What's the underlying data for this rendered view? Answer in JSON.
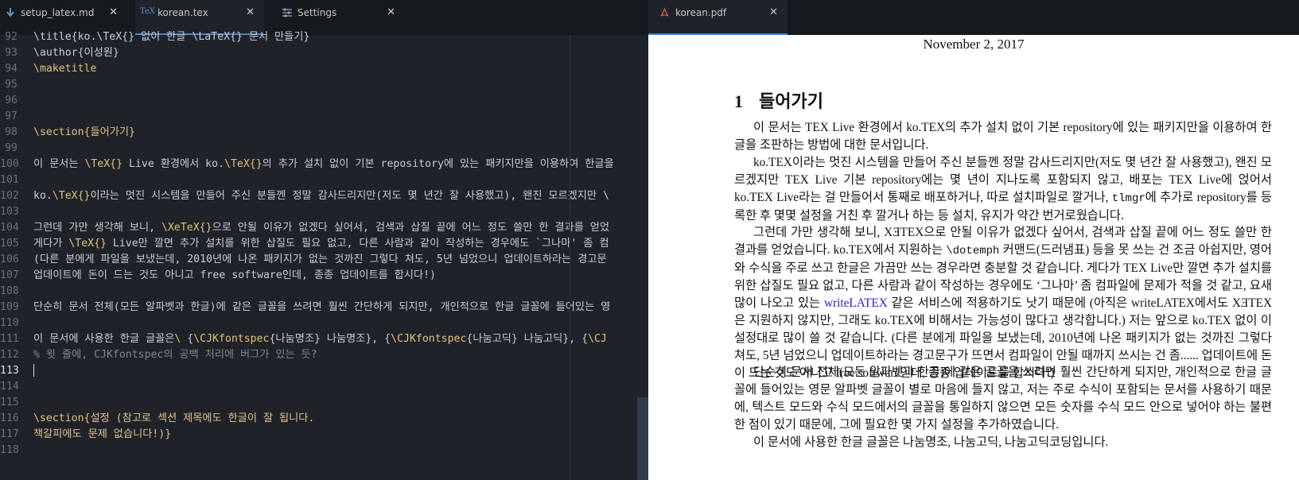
{
  "tabs": [
    {
      "label": "setup_latex.md",
      "icon": "markdown-arrow-icon",
      "active": false
    },
    {
      "label": "korean.tex",
      "icon": "tex-file-icon",
      "active": true
    },
    {
      "label": "Settings",
      "icon": "settings-sliders-icon",
      "active": false
    }
  ],
  "pdf_tab": {
    "label": "korean.pdf",
    "icon": "pdf-file-icon"
  },
  "close_glyph": "✕",
  "editor": {
    "lines": [
      {
        "n": "92",
        "segments": [
          {
            "t": "\\title{ko.\\TeX{} 없이 한글 \\LaTeX{} 문서 만들기}",
            "c": "txt"
          }
        ]
      },
      {
        "n": "93",
        "segments": [
          {
            "t": "\\author",
            "c": "txt"
          },
          {
            "t": "{이성원}",
            "c": "txt"
          }
        ]
      },
      {
        "n": "94",
        "segments": [
          {
            "t": "\\maketitle",
            "c": "kw"
          }
        ]
      },
      {
        "n": "95",
        "segments": []
      },
      {
        "n": "96",
        "segments": []
      },
      {
        "n": "97",
        "segments": []
      },
      {
        "n": "98",
        "segments": [
          {
            "t": "\\section{들어가기}",
            "c": "kw"
          }
        ]
      },
      {
        "n": "99",
        "segments": []
      },
      {
        "n": "100",
        "segments": [
          {
            "t": "이 문서는 ",
            "c": "txt"
          },
          {
            "t": "\\TeX{}",
            "c": "kw"
          },
          {
            "t": " Live 환경에서 ko.",
            "c": "txt"
          },
          {
            "t": "\\TeX{}",
            "c": "kw"
          },
          {
            "t": "의 추가 설치 없이 기본 repository에 있는 패키지만을 이용하여 한글을",
            "c": "txt"
          }
        ]
      },
      {
        "n": "101",
        "segments": []
      },
      {
        "n": "102",
        "segments": [
          {
            "t": "ko.",
            "c": "txt"
          },
          {
            "t": "\\TeX{}",
            "c": "kw"
          },
          {
            "t": "이라는 멋진 시스템을 만들어 주신 분들껜 정말 감사드리지만(저도 몇 년간 잘 사용했고), 왠진 모르겠지만 \\",
            "c": "txt"
          }
        ]
      },
      {
        "n": "103",
        "segments": []
      },
      {
        "n": "104",
        "segments": [
          {
            "t": "그런데 가만 생각해 보니, ",
            "c": "txt"
          },
          {
            "t": "\\XeTeX{}",
            "c": "kw"
          },
          {
            "t": "으로 안될 이유가 없겠다 싶어서, 검색과 삽질 끝에 어느 정도 쓸만 한 결과를 얻었",
            "c": "txt"
          }
        ]
      },
      {
        "n": "105",
        "segments": [
          {
            "t": "게다가 ",
            "c": "txt"
          },
          {
            "t": "\\TeX{}",
            "c": "kw"
          },
          {
            "t": " Live만 깔면 추가 설치를 위한 삽질도 필요 없고, 다른 사람과 같이 작성하는 경우에도 `그나마' 좀 컴",
            "c": "txt"
          }
        ]
      },
      {
        "n": "106",
        "segments": [
          {
            "t": "(다른 분에게 파일을 보냈는데, 2010년에 나온 패키지가 없는 것까진 그렇다 쳐도, 5년 넘었으니 업데이트하라는 경고문",
            "c": "txt"
          }
        ]
      },
      {
        "n": "107",
        "segments": [
          {
            "t": "업데이트에 돈이 드는 것도 아니고 free software인데, 종종 업데이트를 합시다!)",
            "c": "txt"
          }
        ]
      },
      {
        "n": "108",
        "segments": []
      },
      {
        "n": "109",
        "segments": [
          {
            "t": "단순히 문서 전체(모든 알파벳과 한글)에 같은 글꼴을 쓰려면 훨씬 간단하게 되지만, 개인적으로 한글 글꼴에 들어있는 영",
            "c": "txt"
          }
        ]
      },
      {
        "n": "110",
        "segments": []
      },
      {
        "n": "111",
        "segments": [
          {
            "t": "이 문서에 사용한 한글 글꼴은",
            "c": "txt"
          },
          {
            "t": "\\ ",
            "c": "kw"
          },
          {
            "t": "{",
            "c": "txt"
          },
          {
            "t": "\\CJKfontspec",
            "c": "kw"
          },
          {
            "t": "{나눔명조} 나눔명조}, {",
            "c": "txt"
          },
          {
            "t": "\\CJKfontspec",
            "c": "kw"
          },
          {
            "t": "{나눔고딕} 나눔고딕}, {",
            "c": "txt"
          },
          {
            "t": "\\CJ",
            "c": "kw"
          }
        ]
      },
      {
        "n": "112",
        "segments": [
          {
            "t": "% 윗 줄에, CJKfontspec의 공백 처리에 버그가 있는 듯?",
            "c": "cm"
          }
        ]
      },
      {
        "n": "113",
        "segments": [],
        "current": true
      },
      {
        "n": "114",
        "segments": []
      },
      {
        "n": "115",
        "segments": []
      },
      {
        "n": "116",
        "segments": [
          {
            "t": "\\section{",
            "c": "kw"
          },
          {
            "t": "설정 (참고로 섹션 제목에도 한글이 잘 됩니다.",
            "c": "str"
          }
        ]
      },
      {
        "n": "117",
        "segments": [
          {
            "t": "책갈피에도 문제 없습니다!)}",
            "c": "str"
          }
        ]
      },
      {
        "n": "118",
        "segments": []
      }
    ]
  },
  "pdf": {
    "date": "November 2, 2017",
    "section_number": "1",
    "section_title": "들어가기",
    "p1": "이 문서는 TEX Live 환경에서 ko.TEX의 추가 설치 없이 기본 repository에 있는 패키지만을 이용하여 한글을 조판하는 방법에 대한 문서입니다.",
    "p2a": "ko.TEX이라는 멋진 시스템을 만들어 주신 분들껜 정말 감사드리지만(저도 몇 년간 잘 사용했고), 왠진 모르겠지만 TEX Live 기본 repository에는 몇 년이 지나도록 포함되지 않고, 배포는 TEX Live에 얹어서 ko.TEX Live라는 걸 만들어서 통째로 배포하거나, 따로 설치파일로 깔거나, ",
    "p2_mono": "tlmgr",
    "p2b": "에 추가로 repository를 등록한 후 몇몇 설정을 거친 후 깔거나 하는 등 설치, 유지가 약간 번거로웠습니다.",
    "p3a": "그런데 가만 생각해 보니, XƎTEX으로 안될 이유가 없겠다 싶어서, 검색과 삽질 끝에 어느 정도 쓸만 한 결과를 얻었습니다. ko.TEX에서 지원하는 ",
    "p3_mono": "\\dotemph",
    "p3b": " 커맨드(드러냄표) 등을 못 쓰는 건 조금 아쉽지만, 영어와 수식을 주로 쓰고 한글은 가끔만 쓰는 경우라면 충분할 것 같습니다. 게다가 TEX Live만 깔면 추가 설치를 위한 삽질도 필요 없고, 다른 사람과 같이 작성하는 경우에도 ‘그나마’ 좀 컴파일에 문제가 적을 것 같고, 요새 많이 나오고 있는 ",
    "p3_link": "writeLATEX",
    "p3c": " 같은 서비스에 적용하기도 낫기 때문에 (아직은 writeLATEX에서도 XƎTEX은 지원하지 않지만, 그래도 ko.TEX에 비해서는 가능성이 많다고 생각합니다.) 저는 앞으로 ko.TEX 없이 이 설정대로 많이 쓸 것 같습니다. (다른 분에게 파일을 보냈는데, 2010년에 나온 패키지가 없는 것까진 그렇다 쳐도, 5년 넘었으니 업데이트하라는 경고문구가 뜨면서 컴파일이 안될 때까지 쓰시는 건 좀...... 업데이트에 돈이 드는 것도 아니고 free software인데, 종종 업데이트를 합시다!)",
    "p4": "단순히 문서 전체(모든 알파벳과 한글)에 같은 글꼴을 쓰려면 훨씬 간단하게 되지만, 개인적으로 한글 글꼴에 들어있는 영문 알파벳 글꼴이 별로 마음에 들지 않고, 저는 주로 수식이 포함되는 문서를 사용하기 때문에, 텍스트 모드와 수식 모드에서의 글꼴을 통일하지 않으면 모든 숫자를 수식 모드 안으로 넣어야 하는 불편한 점이 있기 때문에, 그에 필요한 몇 가지 설정을 추가하였습니다.",
    "p5": "이 문서에 사용한 한글 글꼴은 나눔명조, 나눔고딕, 나눔고딕코딩입니다."
  }
}
